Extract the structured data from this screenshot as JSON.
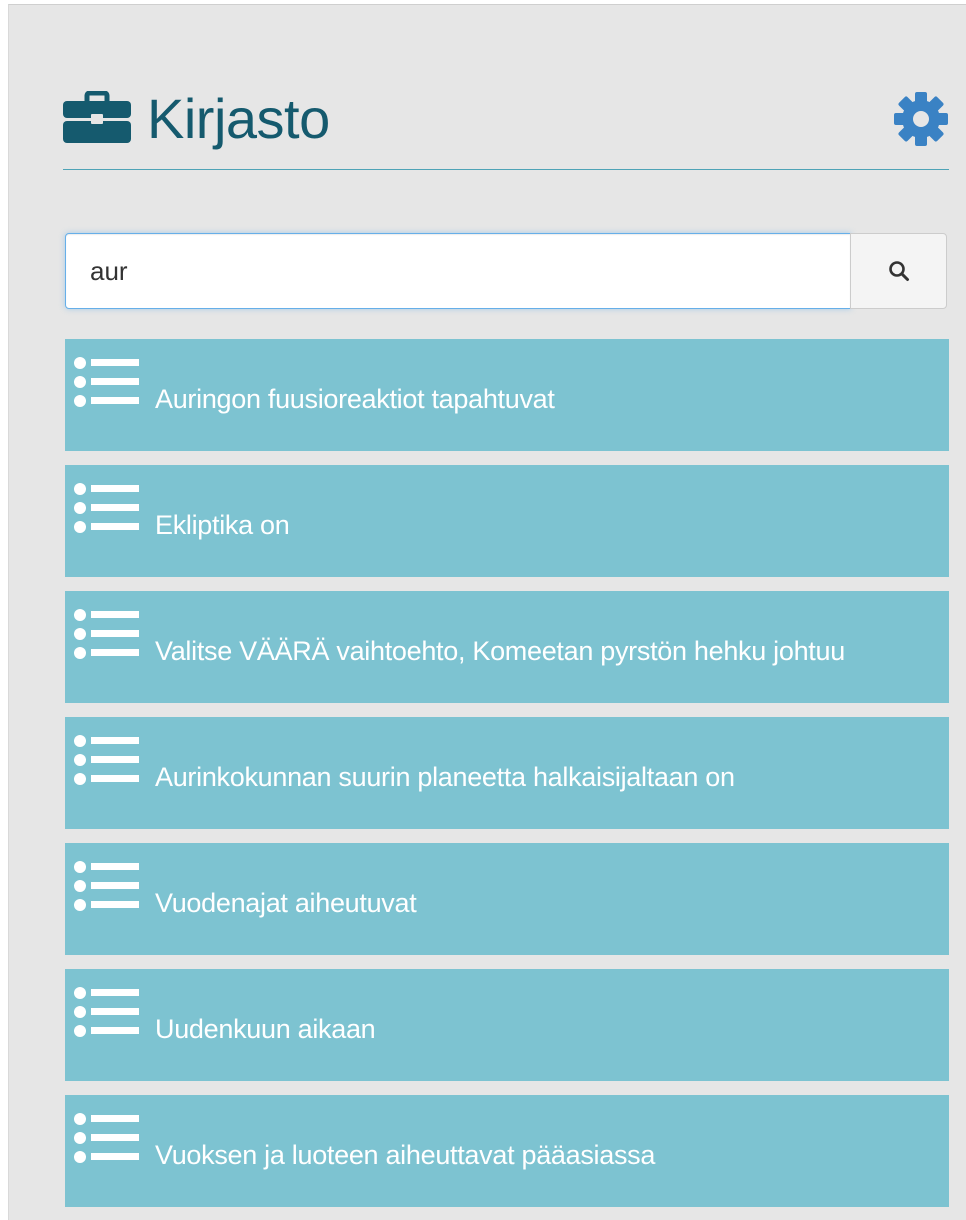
{
  "header": {
    "title": "Kirjasto",
    "title_icon": "briefcase-icon",
    "settings_icon": "gear-icon"
  },
  "search": {
    "value": "aur",
    "button_icon": "search-icon"
  },
  "results": [
    {
      "label": "Auringon fuusioreaktiot tapahtuvat",
      "icon": "list-icon"
    },
    {
      "label": "Ekliptika on",
      "icon": "list-icon"
    },
    {
      "label": "Valitse VÄÄRÄ vaihtoehto, Komeetan pyrstön hehku johtuu",
      "icon": "list-icon"
    },
    {
      "label": "Aurinkokunnan suurin planeetta halkaisijaltaan on",
      "icon": "list-icon"
    },
    {
      "label": "Vuodenajat aiheutuvat",
      "icon": "list-icon"
    },
    {
      "label": "Uudenkuun aikaan",
      "icon": "list-icon"
    },
    {
      "label": "Vuoksen ja luoteen aiheuttavat pääasiassa",
      "icon": "list-icon"
    }
  ],
  "colors": {
    "panel_background": "#e6e6e6",
    "title": "#155a6e",
    "divider": "#4ea3b6",
    "result_background": "#7dc3d1",
    "result_text": "#ffffff",
    "gear": "#3a82c4"
  }
}
